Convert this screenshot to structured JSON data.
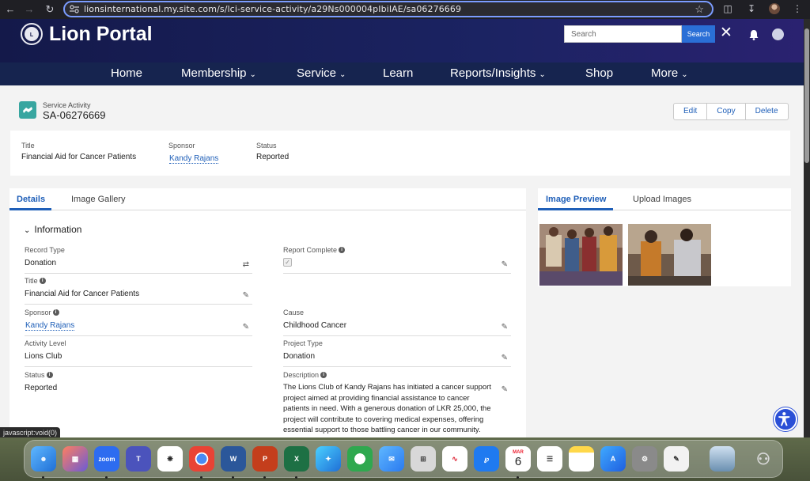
{
  "browser": {
    "url": "lionsinternational.my.site.com/s/lci-service-activity/a29Ns000004pIbiIAE/sa06276669",
    "status_tip": "javascript:void(0)"
  },
  "header": {
    "title": "Lion Portal",
    "search_placeholder": "Search",
    "search_button": "Search"
  },
  "nav": [
    {
      "label": "Home",
      "chevron": false
    },
    {
      "label": "Membership",
      "chevron": true
    },
    {
      "label": "Service",
      "chevron": true
    },
    {
      "label": "Learn",
      "chevron": false
    },
    {
      "label": "Reports/Insights",
      "chevron": true
    },
    {
      "label": "Shop",
      "chevron": false
    },
    {
      "label": "More",
      "chevron": true
    }
  ],
  "record": {
    "type": "Service Activity",
    "name": "SA-06276669",
    "actions": {
      "edit": "Edit",
      "copy": "Copy",
      "delete": "Delete"
    }
  },
  "highlights": {
    "title_label": "Title",
    "title_value": "Financial Aid for Cancer Patients",
    "sponsor_label": "Sponsor",
    "sponsor_value": "Kandy Rajans",
    "status_label": "Status",
    "status_value": "Reported"
  },
  "details": {
    "tabs": {
      "details": "Details",
      "gallery": "Image Gallery"
    },
    "section": "Information",
    "record_type_label": "Record Type",
    "record_type_value": "Donation",
    "report_complete_label": "Report Complete",
    "report_complete_checked": true,
    "title_label": "Title",
    "title_value": "Financial Aid for Cancer Patients",
    "sponsor_label": "Sponsor",
    "sponsor_value": "Kandy Rajans",
    "cause_label": "Cause",
    "cause_value": "Childhood Cancer",
    "activity_level_label": "Activity Level",
    "activity_level_value": "Lions Club",
    "project_type_label": "Project Type",
    "project_type_value": "Donation",
    "status_label": "Status",
    "status_value": "Reported",
    "description_label": "Description",
    "description_value": "The Lions Club of Kandy Rajans has initiated a cancer support project aimed at providing financial assistance to cancer patients in need. With a generous donation of LKR 25,000, the project will contribute to covering medical expenses, offering essential support to those battling cancer in our community."
  },
  "preview": {
    "tab_preview": "Image Preview",
    "tab_upload": "Upload Images"
  },
  "dock": {
    "zoom_label": "zoom",
    "calendar_month": "MAR",
    "calendar_day": "6"
  },
  "colors": {
    "brand_dark": "#16244f",
    "link": "#1f5fb8",
    "accent_teal": "#38a6a0"
  }
}
